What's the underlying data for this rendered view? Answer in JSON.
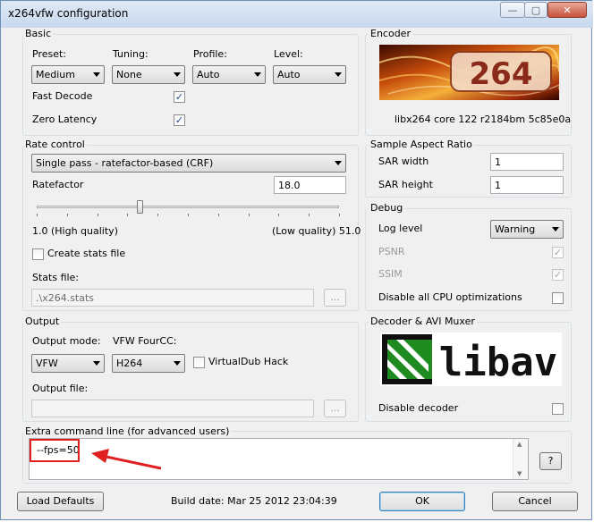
{
  "window": {
    "title": "x264vfw configuration",
    "minimize": "—",
    "restore": "▢",
    "close": "✕"
  },
  "basic": {
    "legend": "Basic",
    "preset_label": "Preset:",
    "preset_value": "Medium",
    "tuning_label": "Tuning:",
    "tuning_value": "None",
    "profile_label": "Profile:",
    "profile_value": "Auto",
    "level_label": "Level:",
    "level_value": "Auto",
    "fast_decode_label": "Fast Decode",
    "fast_decode_checked": true,
    "zero_latency_label": "Zero Latency",
    "zero_latency_checked": true
  },
  "encoder": {
    "legend": "Encoder",
    "logo_text": "264",
    "version": "libx264 core 122 r2184bm 5c85e0a"
  },
  "rate_control": {
    "legend": "Rate control",
    "mode_value": "Single pass - ratefactor-based (CRF)",
    "ratefactor_label": "Ratefactor",
    "ratefactor_value": "18.0",
    "ratefactor_slider_fraction": 0.34,
    "min_label": "1.0 (High quality)",
    "max_label": "(Low quality) 51.0",
    "create_stats_label": "Create stats file",
    "create_stats_checked": false,
    "stats_file_label": "Stats file:",
    "stats_file_value": ".\\x264.stats",
    "browse_label": "..."
  },
  "sar": {
    "legend": "Sample Aspect Ratio",
    "width_label": "SAR width",
    "width_value": "1",
    "height_label": "SAR height",
    "height_value": "1"
  },
  "debug": {
    "legend": "Debug",
    "log_level_label": "Log level",
    "log_level_value": "Warning",
    "psnr_label": "PSNR",
    "psnr_checked": true,
    "ssim_label": "SSIM",
    "ssim_checked": true,
    "cpu_opt_label": "Disable all CPU optimizations",
    "cpu_opt_checked": false
  },
  "output": {
    "legend": "Output",
    "mode_label": "Output mode:",
    "mode_value": "VFW",
    "fourcc_label": "VFW FourCC:",
    "fourcc_value": "H264",
    "vdub_label": "VirtualDub Hack",
    "vdub_checked": false,
    "file_label": "Output file:",
    "file_value": "",
    "browse_label": "..."
  },
  "decoder": {
    "legend": "Decoder & AVI Muxer",
    "logo_text": "libav",
    "disable_label": "Disable decoder",
    "disable_checked": false
  },
  "extra": {
    "legend": "Extra command line (for advanced users)",
    "value": "--fps=50",
    "help_label": "?"
  },
  "footer": {
    "load_defaults": "Load Defaults",
    "build_date": "Build date: Mar 25 2012 23:04:39",
    "ok": "OK",
    "cancel": "Cancel"
  },
  "colors": {
    "annotation": "#e02020",
    "panel_border": "#d5dfe5"
  }
}
